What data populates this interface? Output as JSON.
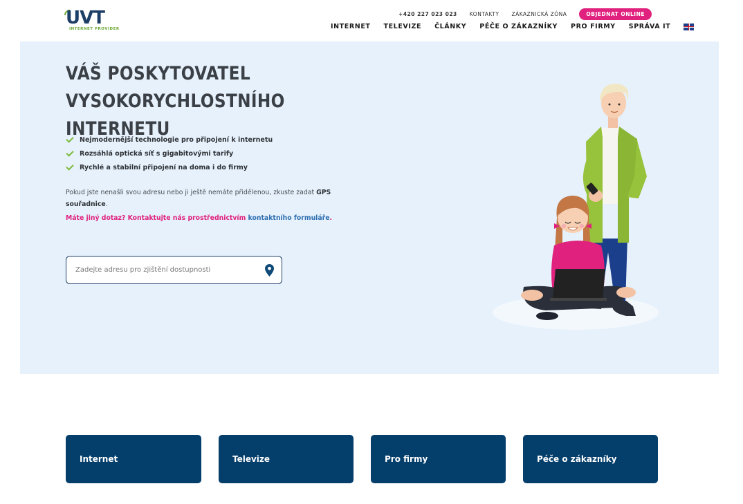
{
  "header": {
    "logo_text": "UVT",
    "logo_subtext": "INTERNET PROVIDER",
    "topbar": {
      "phone": "+420 227 023 023",
      "contacts": "KONTAKTY",
      "customer_zone": "ZÁKAZNICKÁ ZÓNA",
      "order_button": "OBJEDNAT ONLINE"
    },
    "nav": [
      {
        "label": "INTERNET"
      },
      {
        "label": "TELEVIZE"
      },
      {
        "label": "ČLÁNKY"
      },
      {
        "label": "PÉČE O ZÁKAZNÍKY"
      },
      {
        "label": "PRO FIRMY"
      },
      {
        "label": "SPRÁVA IT"
      }
    ],
    "language_icon": "uk-flag-icon"
  },
  "hero": {
    "title_line1": "VÁŠ POSKYTOVATEL",
    "title_line2": "VYSOKORYCHLOSTNÍHO INTERNETU",
    "features": [
      {
        "text": "Nejmodernější technologie pro připojení k internetu"
      },
      {
        "text": "Rozsáhlá optická síť s gigabitovými tarify"
      },
      {
        "text": "Rychlé a stabilní připojení na doma i do firmy"
      }
    ],
    "description_prefix": "Pokud jste nenašli svou adresu nebo ji ještě nemáte přidělenou, zkuste zadat ",
    "description_bold": "GPS souřadnice",
    "description_suffix": ".",
    "contact_prefix": "Máte jiný dotaz? Kontaktujte nás prostřednictvím ",
    "contact_link": "kontaktního formuláře",
    "contact_suffix": ".",
    "search_placeholder": "Zadejte adresu pro zjištění dostupnosti",
    "search_icon": "map-pin-icon"
  },
  "cards": [
    {
      "label": "Internet"
    },
    {
      "label": "Televize"
    },
    {
      "label": "Pro firmy"
    },
    {
      "label": "Péče o zákazníky"
    }
  ],
  "colors": {
    "brand_navy": "#043e6b",
    "accent_pink": "#e0217e",
    "accent_green": "#7bb93b",
    "hero_bg": "#e6f1fc",
    "link_blue": "#2f6fb0"
  }
}
